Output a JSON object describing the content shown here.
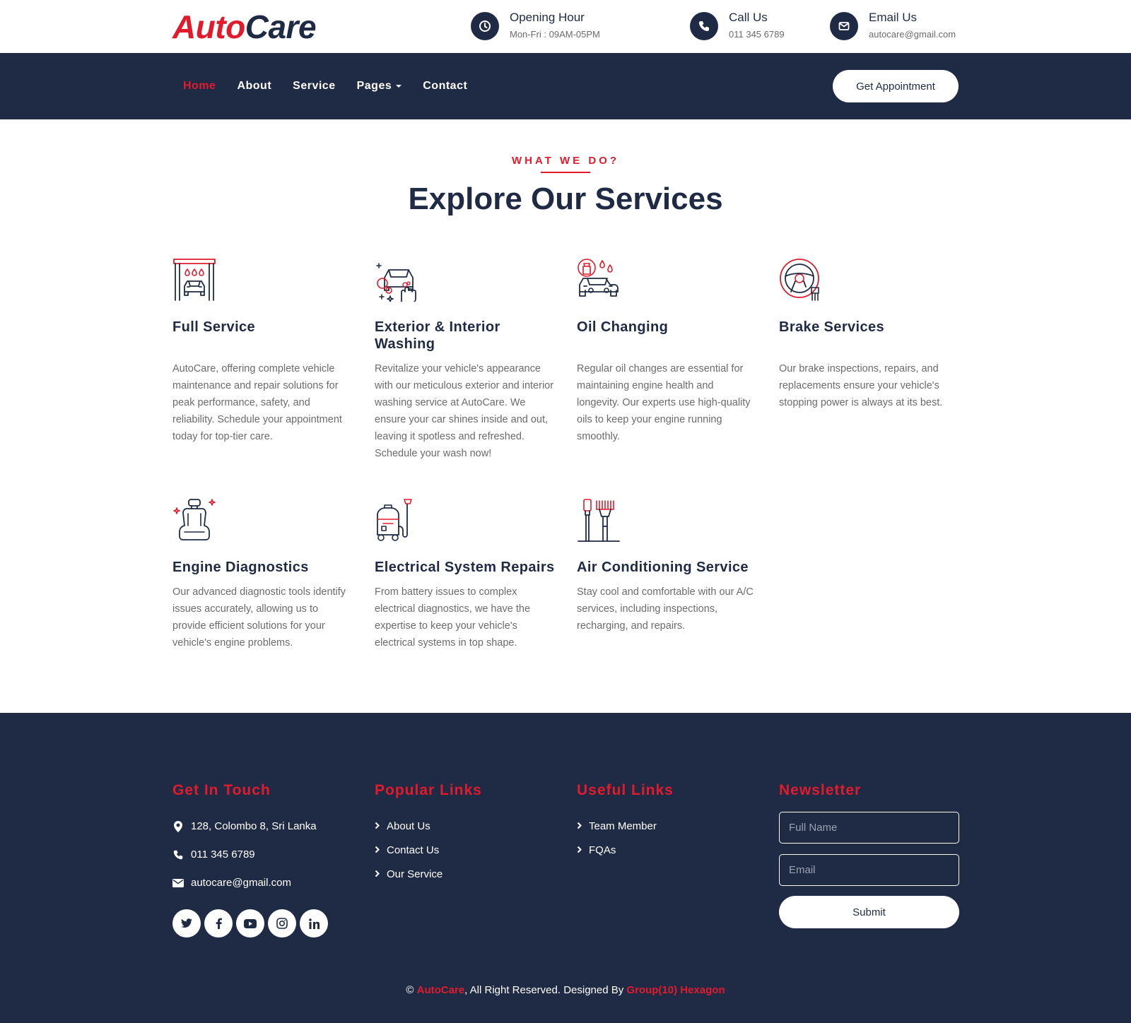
{
  "brand": {
    "part1": "Auto",
    "part2": "Care"
  },
  "contact": {
    "hours": {
      "title": "Opening Hour",
      "sub": "Mon-Fri : 09AM-05PM"
    },
    "call": {
      "title": "Call Us",
      "sub": "011 345 6789"
    },
    "email": {
      "title": "Email Us",
      "sub": "autocare@gmail.com"
    }
  },
  "nav": {
    "items": [
      "Home",
      "About",
      "Service",
      "Pages",
      "Contact"
    ],
    "active": "Home",
    "cta": "Get Appointment"
  },
  "services": {
    "eyebrow": "WHAT WE DO?",
    "title": "Explore Our Services",
    "items": [
      {
        "title": "Full Service",
        "desc": "AutoCare, offering complete vehicle maintenance and repair solutions for peak performance, safety, and reliability. Schedule your appointment today for top-tier care.",
        "icon": "car-wash-bay-icon"
      },
      {
        "title": "Exterior & Interior Washing",
        "desc": "Revitalize your vehicle's appearance with our meticulous exterior and interior washing service at AutoCare. We ensure your car shines inside and out, leaving it spotless and refreshed. Schedule your wash now!",
        "icon": "car-washing-hand-icon"
      },
      {
        "title": "Oil Changing",
        "desc": "Regular oil changes are essential for maintaining engine health and longevity. Our experts use high-quality oils to keep your engine running smoothly.",
        "icon": "oil-car-icon"
      },
      {
        "title": "Brake Services",
        "desc": "Our brake inspections, repairs, and replacements ensure your vehicle's stopping power is always at its best.",
        "icon": "steering-wheel-icon"
      },
      {
        "title": "Engine Diagnostics",
        "desc": "Our advanced diagnostic tools identify issues accurately, allowing us to provide efficient solutions for your vehicle's engine problems.",
        "icon": "car-seat-icon"
      },
      {
        "title": "Electrical System Repairs",
        "desc": "From battery issues to complex electrical diagnostics, we have the expertise to keep your vehicle's electrical systems in top shape.",
        "icon": "vacuum-cleaner-icon"
      },
      {
        "title": "Air Conditioning Service",
        "desc": "Stay cool and comfortable with our A/C services, including inspections, recharging, and repairs.",
        "icon": "brushes-icon"
      }
    ]
  },
  "footer": {
    "touch": {
      "title": "Get In Touch",
      "address": "128, Colombo 8, Sri Lanka",
      "phone": "011 345 6789",
      "email": "autocare@gmail.com",
      "socials": [
        "twitter-icon",
        "facebook-icon",
        "youtube-icon",
        "instagram-icon",
        "linkedin-icon"
      ]
    },
    "popular": {
      "title": "Popular Links",
      "links": [
        "About Us",
        "Contact Us",
        "Our Service"
      ]
    },
    "useful": {
      "title": "Useful Links",
      "links": [
        "Team Member",
        "FQAs"
      ]
    },
    "newsletter": {
      "title": "Newsletter",
      "name_placeholder": "Full Name",
      "email_placeholder": "Email",
      "submit": "Submit"
    },
    "copyright": {
      "symbol": "©",
      "brand": "AutoCare",
      "middle": ", All Right Reserved. Designed By ",
      "designer": "Group(10) Hexagon"
    }
  },
  "colors": {
    "navy": "#1f2a44",
    "red": "#e21b2c",
    "white": "#ffffff"
  }
}
